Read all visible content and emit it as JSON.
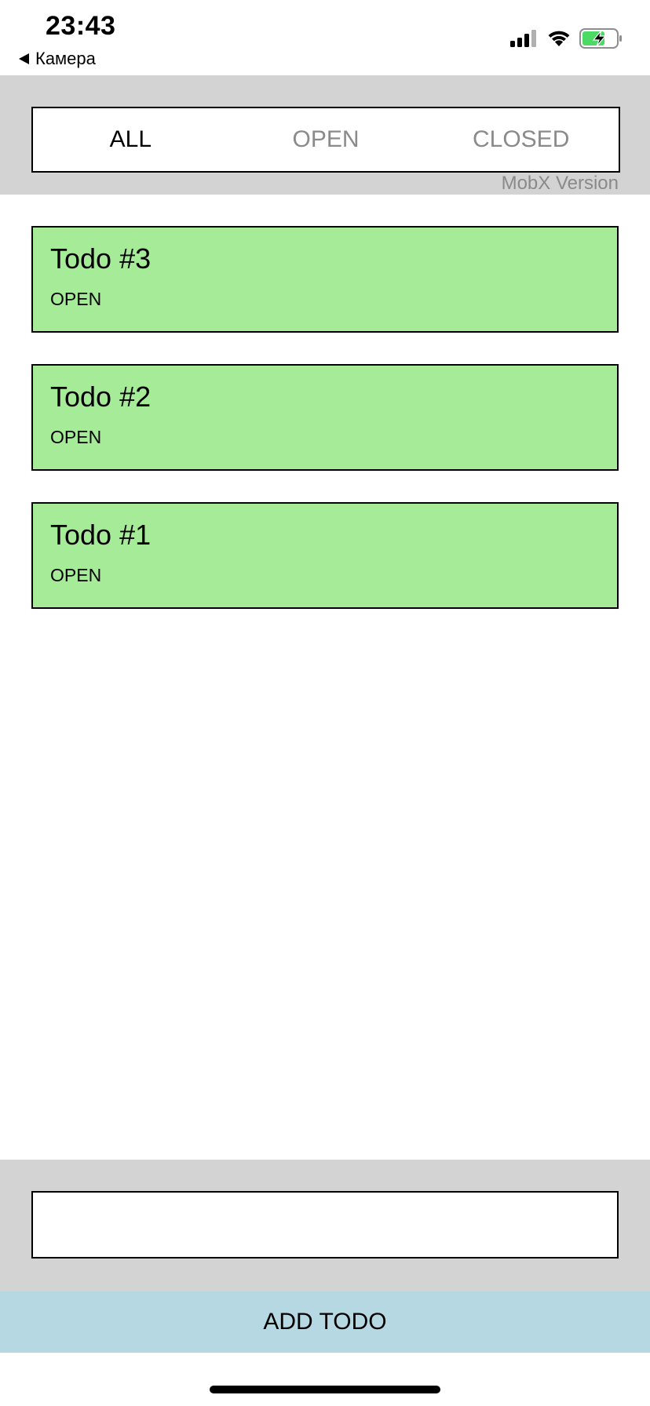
{
  "status_bar": {
    "time": "23:43",
    "back_label": "Камера",
    "icons": [
      "signal-icon",
      "wifi-icon",
      "battery-charging-icon"
    ],
    "battery_color": "#4cd964"
  },
  "filters": {
    "tabs": [
      {
        "label": "ALL",
        "active": true
      },
      {
        "label": "OPEN",
        "active": false
      },
      {
        "label": "CLOSED",
        "active": false
      }
    ],
    "version_label": "MobX Version"
  },
  "todos": [
    {
      "title": "Todo #3",
      "status": "OPEN"
    },
    {
      "title": "Todo #2",
      "status": "OPEN"
    },
    {
      "title": "Todo #1",
      "status": "OPEN"
    }
  ],
  "footer": {
    "input_value": "",
    "input_placeholder": "",
    "add_button_label": "ADD TODO"
  },
  "colors": {
    "header_bg": "#d3d3d3",
    "todo_open_bg": "#a6eb98",
    "add_button_bg": "#b5d8e3"
  }
}
